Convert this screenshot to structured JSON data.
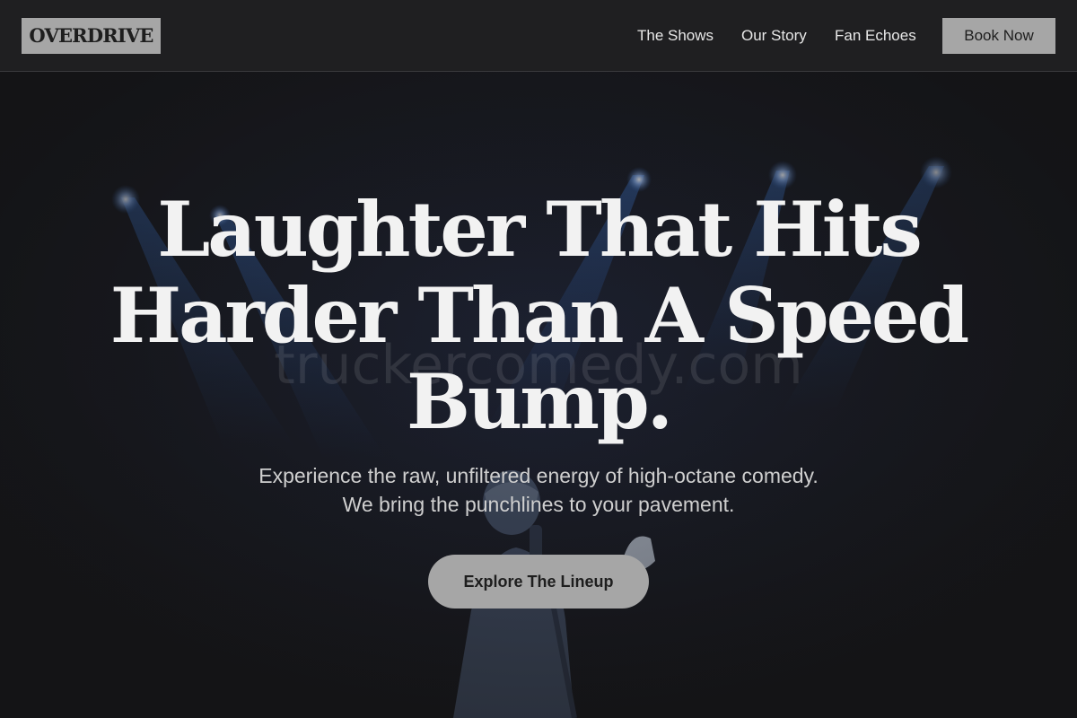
{
  "brand": {
    "logo_text": "OVERDRIVE"
  },
  "nav": {
    "items": [
      {
        "label": "The Shows"
      },
      {
        "label": "Our Story"
      },
      {
        "label": "Fan Echoes"
      }
    ],
    "cta_label": "Book Now"
  },
  "hero": {
    "headline": "Laughter That Hits Harder Than A Speed Bump.",
    "subtitle": "Experience the raw, unfiltered energy of high-octane comedy. We bring the punchlines to your pavement.",
    "cta_label": "Explore The Lineup",
    "watermark": "truckercomedy.com",
    "background": "stage-performer-with-spotlights"
  },
  "colors": {
    "header_bg": "#1f1f21",
    "page_bg": "#141416",
    "button_bg": "#a6a6a6",
    "button_text": "#1e1e1e",
    "headline_text": "#f2f2f2",
    "spotlight": "#2f5fa8"
  }
}
